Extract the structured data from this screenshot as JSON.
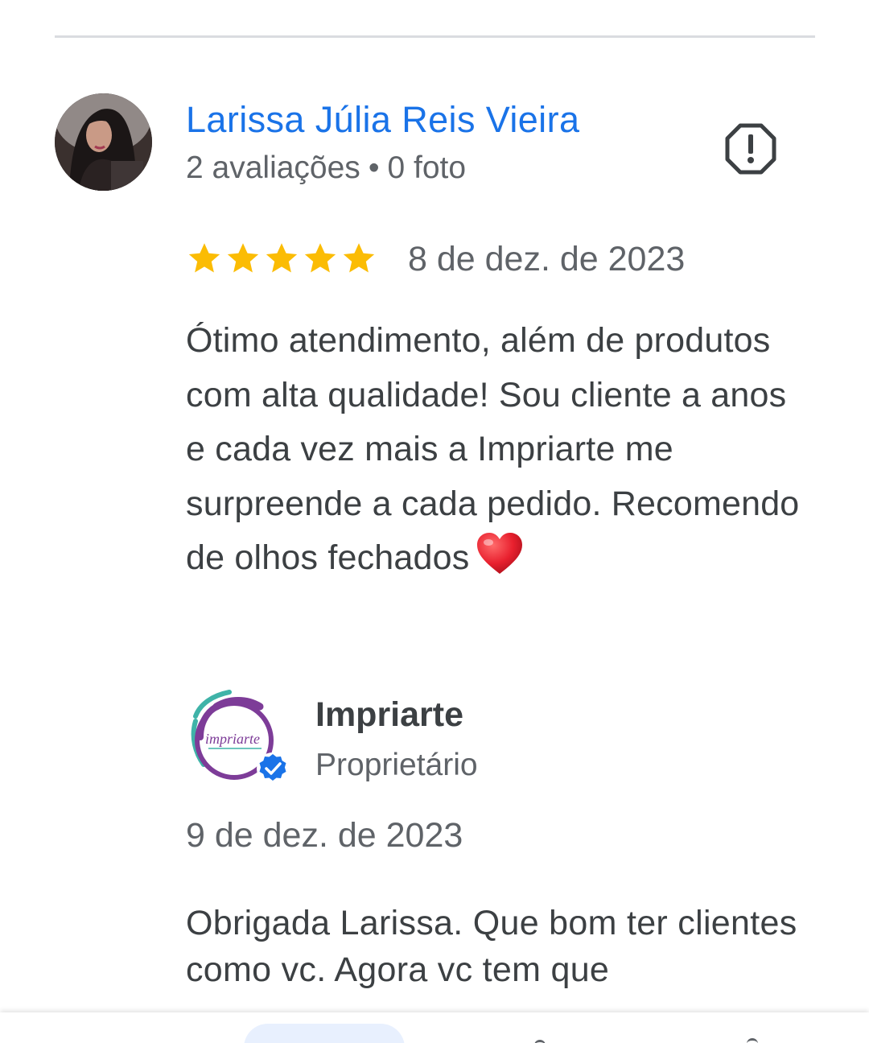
{
  "review": {
    "author_name": "Larissa Júlia Reis Vieira",
    "reviews_count": "2 avaliações",
    "separator": "•",
    "photos_count": "0 foto",
    "rating": 5,
    "rating_max": 5,
    "date": "8 de dez. de 2023",
    "text": "Ótimo atendimento, além de produtos com alta qualidade! Sou cliente a anos e cada vez mais a Impriarte me surpreende a cada pedido. Recomendo de olhos fechados",
    "emoji": "red-heart"
  },
  "owner_reply": {
    "name": "Impriarte",
    "role": "Proprietário",
    "date": "9 de dez. de 2023",
    "text": "Obrigada Larissa. Que bom ter clientes como vc. Agora vc tem que"
  },
  "icons": {
    "report": "report-icon",
    "verified": "verified-badge-icon",
    "star": "star-icon"
  },
  "colors": {
    "author_link": "#1a73e8",
    "star": "#fbbc04",
    "secondary_text": "#5f6368",
    "body_text": "#3c4043",
    "verified": "#1a73e8",
    "heart": "#e8202e"
  }
}
